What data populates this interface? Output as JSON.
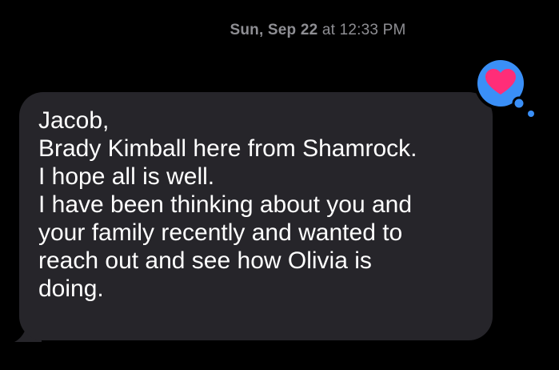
{
  "conversation": {
    "timestamp": {
      "day": "Sun, Sep 22",
      "time": "at 12:33 PM"
    },
    "message": {
      "direction": "incoming",
      "lines": [
        "Jacob,",
        "Brady Kimball here from Shamrock.",
        "I hope all is well.",
        "I have been thinking about you and",
        "your family recently and wanted to",
        "reach out and see how Olivia is",
        "doing."
      ],
      "tapback": {
        "icon": "heart-icon",
        "color": "#ff2d78",
        "bubble_color": "#3a8ff7"
      }
    }
  },
  "colors": {
    "background": "#000000",
    "bubble": "#26252a",
    "timestamp_text": "#8e8e93",
    "message_text": "#ffffff"
  }
}
